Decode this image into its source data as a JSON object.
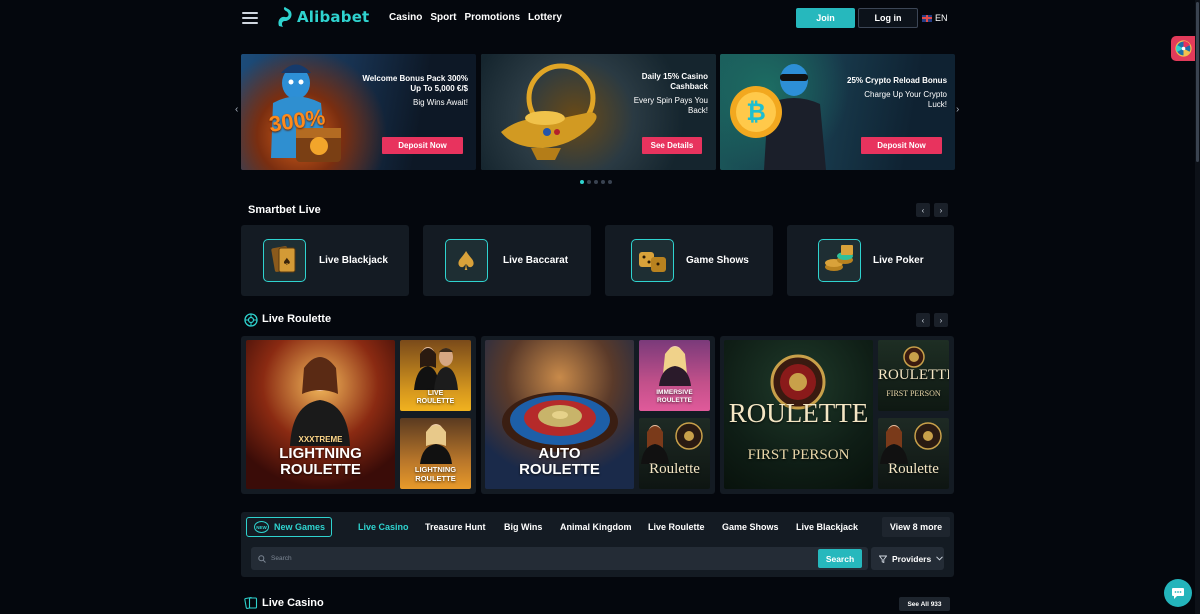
{
  "header": {
    "logo": "Alibabet",
    "nav": [
      "Casino",
      "Sport",
      "Promotions",
      "Lottery"
    ],
    "join_label": "Join",
    "login_label": "Log in",
    "language": "EN"
  },
  "banners": [
    {
      "title": "Welcome Bonus Pack 300% Up To 5,000 €/$",
      "subtitle": "Big Wins Await!",
      "artwork_text": "300%",
      "button": "Deposit Now"
    },
    {
      "title": "Daily 15% Casino Cashback",
      "subtitle": "Every Spin Pays You Back!",
      "button": "See Details"
    },
    {
      "title": "25% Crypto Reload Bonus",
      "subtitle": "Charge Up Your Crypto Luck!",
      "button": "Deposit Now"
    }
  ],
  "carousel": {
    "slides": 5,
    "active": 1
  },
  "smartbet": {
    "title": "Smartbet Live",
    "items": [
      "Live Blackjack",
      "Live Baccarat",
      "Game Shows",
      "Live Poker"
    ]
  },
  "roulette": {
    "title": "Live Roulette",
    "tiles": [
      {
        "line1": "XXXTREME",
        "line2": "LIGHTNING",
        "line3": "ROULETTE"
      },
      {
        "line1": "LIVE",
        "line2": "ROULETTE"
      },
      {
        "line1": "LIGHTNING",
        "line2": "ROULETTE"
      },
      {
        "line1": "AUTO",
        "line2": "ROULETTE"
      },
      {
        "line1": "IMMERSIVE",
        "line2": "ROULETTE"
      },
      {
        "line1": "Roulette"
      },
      {
        "line1": "ROULETTE",
        "line2": "FIRST PERSON"
      },
      {
        "line1": "ROULETTE",
        "line2": "FIRST PERSON"
      },
      {
        "line1": "Roulette"
      }
    ]
  },
  "filters": {
    "new_games": "New Games",
    "new_badge": "NEW",
    "tabs": [
      "Live Casino",
      "Treasure Hunt",
      "Big Wins",
      "Animal Kingdom",
      "Live Roulette",
      "Game Shows",
      "Live Blackjack"
    ],
    "active_tab": "Live Casino",
    "view_more": "View 8 more",
    "search_placeholder": "Search",
    "search_button": "Search",
    "providers": "Providers"
  },
  "live_casino": {
    "title": "Live Casino",
    "see_all": "See All 933"
  },
  "colors": {
    "accent": "#2fd3cf",
    "primary_button": "#26b8bd",
    "promo_button": "#e8335e",
    "background": "#04070d",
    "card": "#141b23"
  }
}
